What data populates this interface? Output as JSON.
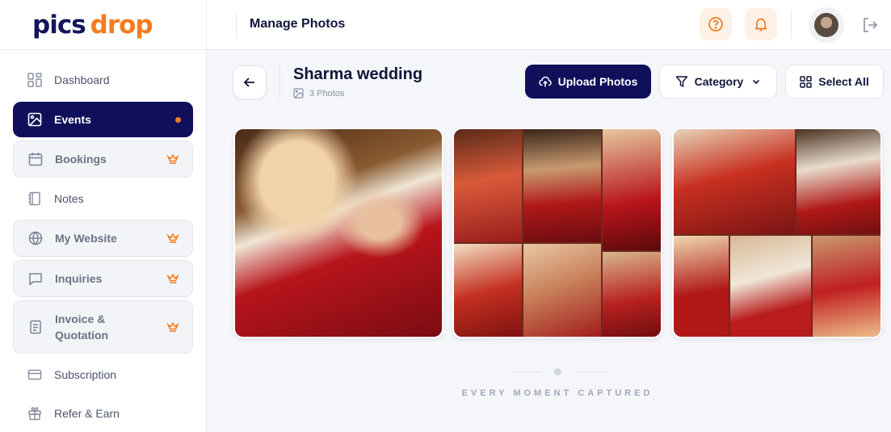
{
  "brand": {
    "part1": "pics",
    "part2": "drop"
  },
  "colors": {
    "navy": "#0f0f5a",
    "accent": "#f47b1f",
    "bg": "#f5f6fa"
  },
  "sidebar": {
    "items": [
      {
        "label": "Dashboard",
        "icon": "dashboard-icon",
        "state": "normal"
      },
      {
        "label": "Events",
        "icon": "image-icon",
        "state": "active"
      },
      {
        "label": "Bookings",
        "icon": "calendar-icon",
        "state": "locked"
      },
      {
        "label": "Notes",
        "icon": "notes-icon",
        "state": "normal"
      },
      {
        "label": "My Website",
        "icon": "globe-icon",
        "state": "locked"
      },
      {
        "label": "Inquiries",
        "icon": "chat-icon",
        "state": "locked"
      },
      {
        "label": "Invoice &",
        "label2": "Quotation",
        "icon": "document-icon",
        "state": "locked"
      },
      {
        "label": "Subscription",
        "icon": "card-icon",
        "state": "normal"
      },
      {
        "label": "Refer & Earn",
        "icon": "gift-icon",
        "state": "normal"
      }
    ]
  },
  "header": {
    "title": "Manage Photos"
  },
  "event": {
    "title": "Sharma wedding",
    "count": "3 Photos"
  },
  "toolbar": {
    "upload": "Upload Photos",
    "category": "Category",
    "select_all": "Select All"
  },
  "photos": [
    {
      "alt": "Couple portrait",
      "icon": "photo-thumbnail"
    },
    {
      "alt": "Wedding collage",
      "icon": "photo-thumbnail"
    },
    {
      "alt": "Ceremony collage",
      "icon": "photo-thumbnail"
    }
  ],
  "footer": {
    "tagline": "EVERY MOMENT CAPTURED"
  }
}
